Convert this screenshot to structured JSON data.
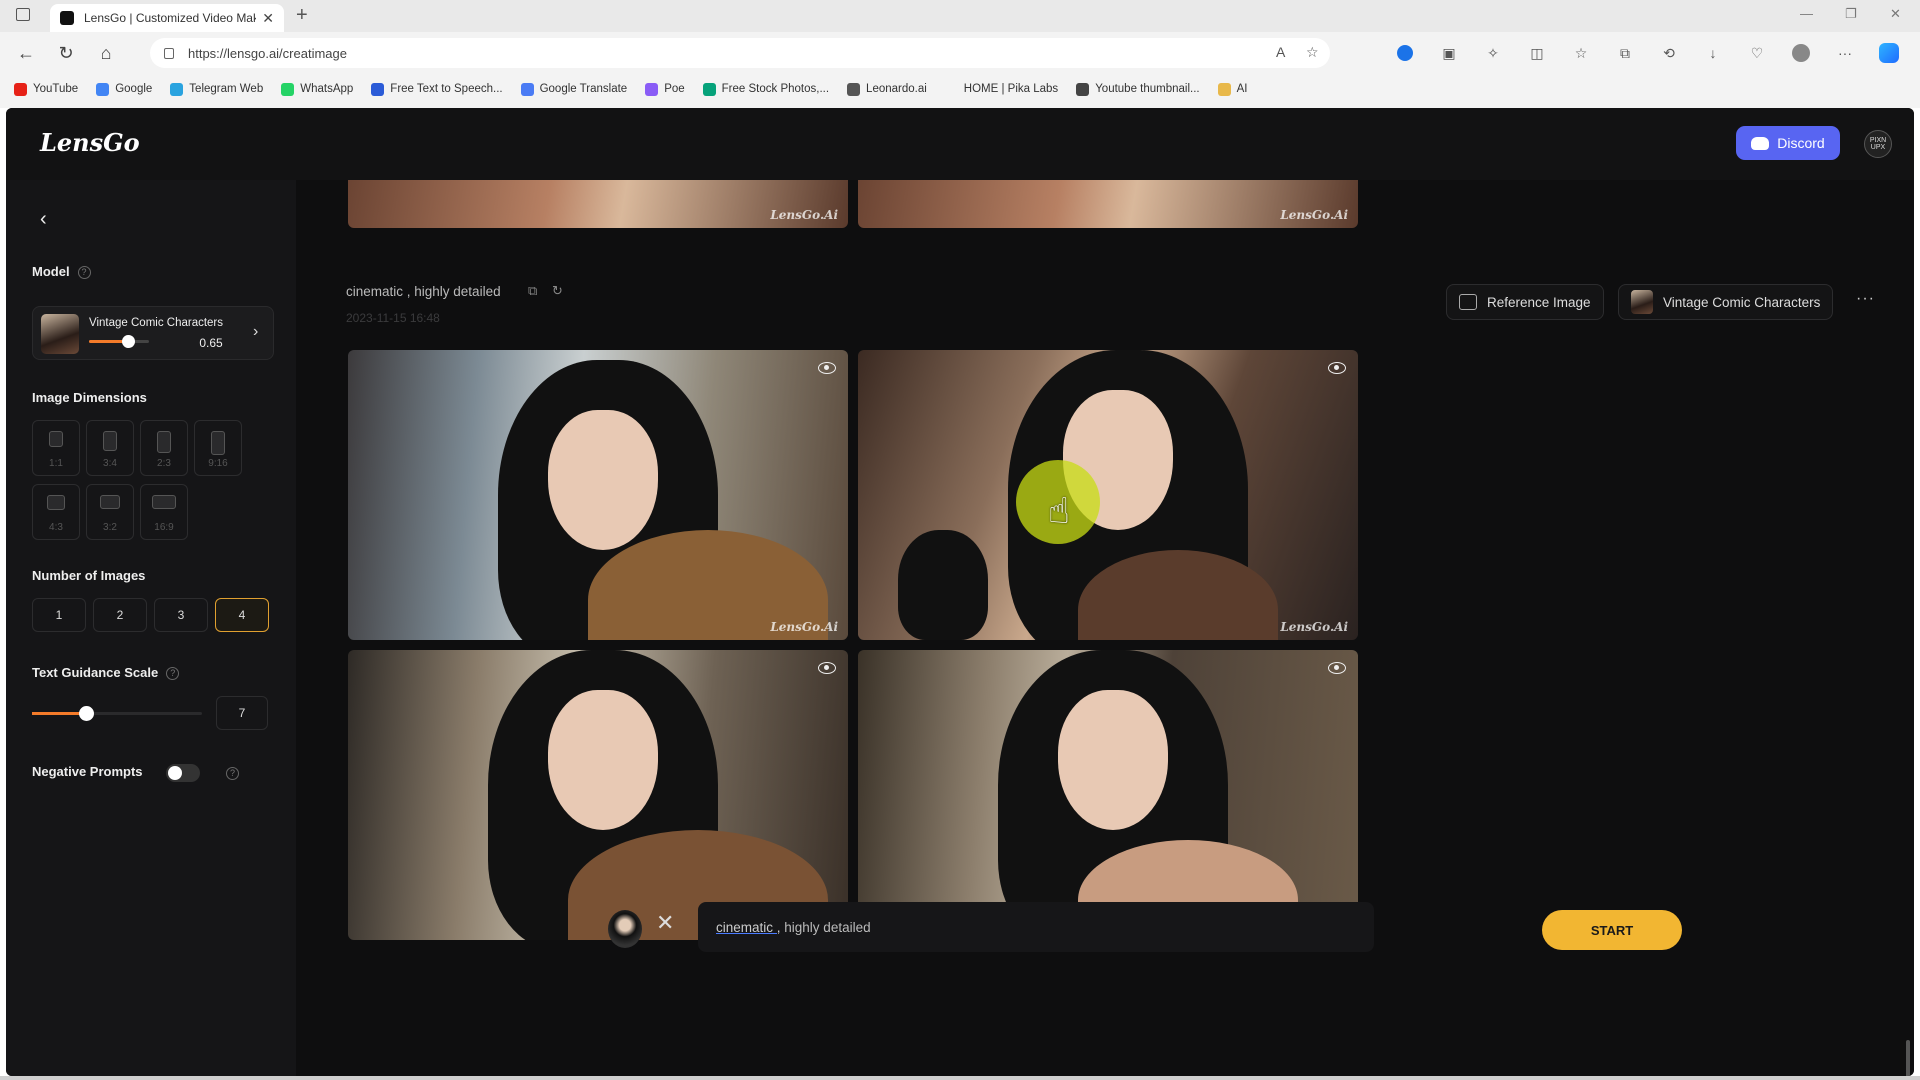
{
  "browser": {
    "tab_title": "LensGo | Customized Video Mak",
    "url": "https://lensgo.ai/creatimage",
    "bookmarks": [
      {
        "label": "YouTube",
        "color": "#e62117"
      },
      {
        "label": "Google",
        "color": "#4285f4"
      },
      {
        "label": "Telegram Web",
        "color": "#2aa3df"
      },
      {
        "label": "WhatsApp",
        "color": "#25d366"
      },
      {
        "label": "Free Text to Speech...",
        "color": "#2b5bd7"
      },
      {
        "label": "Google Translate",
        "color": "#4a7bf4"
      },
      {
        "label": "Poe",
        "color": "#8a5cf6"
      },
      {
        "label": "Free Stock Photos,...",
        "color": "#06a27a"
      },
      {
        "label": "Leonardo.ai",
        "color": "#555555"
      },
      {
        "label": "HOME | Pika Labs",
        "color": "#f3f3f3"
      },
      {
        "label": "Youtube thumbnail...",
        "color": "#444444"
      },
      {
        "label": "AI",
        "color": "#e8b84a"
      }
    ]
  },
  "header": {
    "logo": "LensGo",
    "discord_label": "Discord",
    "avatar_text": "PIXN UPX"
  },
  "sidebar": {
    "model_label": "Model",
    "model_name": "Vintage Comic Characters",
    "model_strength": 0.65,
    "model_value_label": "0.65",
    "dimensions_label": "Image Dimensions",
    "dimensions": [
      "1:1",
      "3:4",
      "2:3",
      "9:16",
      "4:3",
      "3:2",
      "16:9"
    ],
    "num_images_label": "Number of Images",
    "num_images": [
      "1",
      "2",
      "3",
      "4"
    ],
    "num_images_selected": "4",
    "guidance_label": "Text Guidance Scale",
    "guidance_value": "7",
    "guidance_fraction": 0.32,
    "negative_label": "Negative Prompts",
    "negative_on": false
  },
  "main": {
    "prompt": "cinematic , highly detailed",
    "date": "2023-11-15 16:48",
    "reference_label": "Reference Image",
    "model_pill": "Vintage Comic Characters",
    "watermark": "LensGo.Ai"
  },
  "bottombar": {
    "prompt_first": "cinematic ,",
    "prompt_rest": " highly detailed",
    "start_label": "START"
  },
  "colors": {
    "accent": "#f2b632",
    "slider": "#f47b2a",
    "discord": "#5865f2",
    "background": "#0e0e0f"
  }
}
